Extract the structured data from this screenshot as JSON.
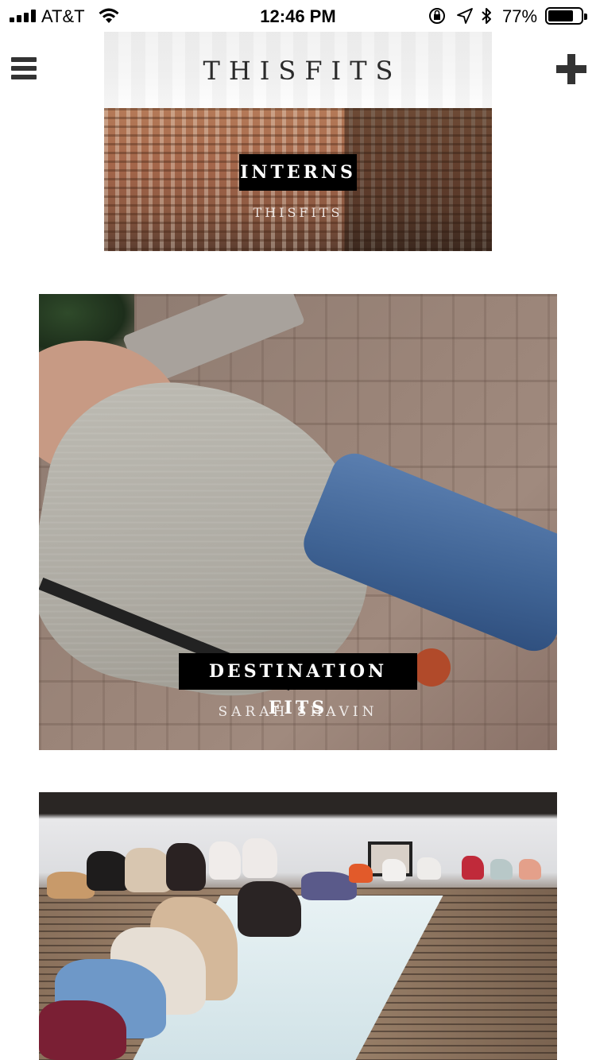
{
  "status_bar": {
    "carrier": "AT&T",
    "time": "12:46 PM",
    "battery_percent": "77%",
    "battery_level": 0.77,
    "icons": [
      "signal-icon",
      "wifi-icon",
      "orientation-lock-icon",
      "location-icon",
      "bluetooth-icon",
      "battery-icon"
    ]
  },
  "header": {
    "logo": "THISFITS",
    "menu_icon": "hamburger-menu-icon",
    "add_icon": "plus-icon"
  },
  "cards": [
    {
      "title": "INTERNS",
      "subtitle": "THISFITS"
    },
    {
      "title": "DESTINATION FITS",
      "subtitle": "SARAH SHAVIN"
    },
    {
      "title": "",
      "subtitle": ""
    }
  ]
}
